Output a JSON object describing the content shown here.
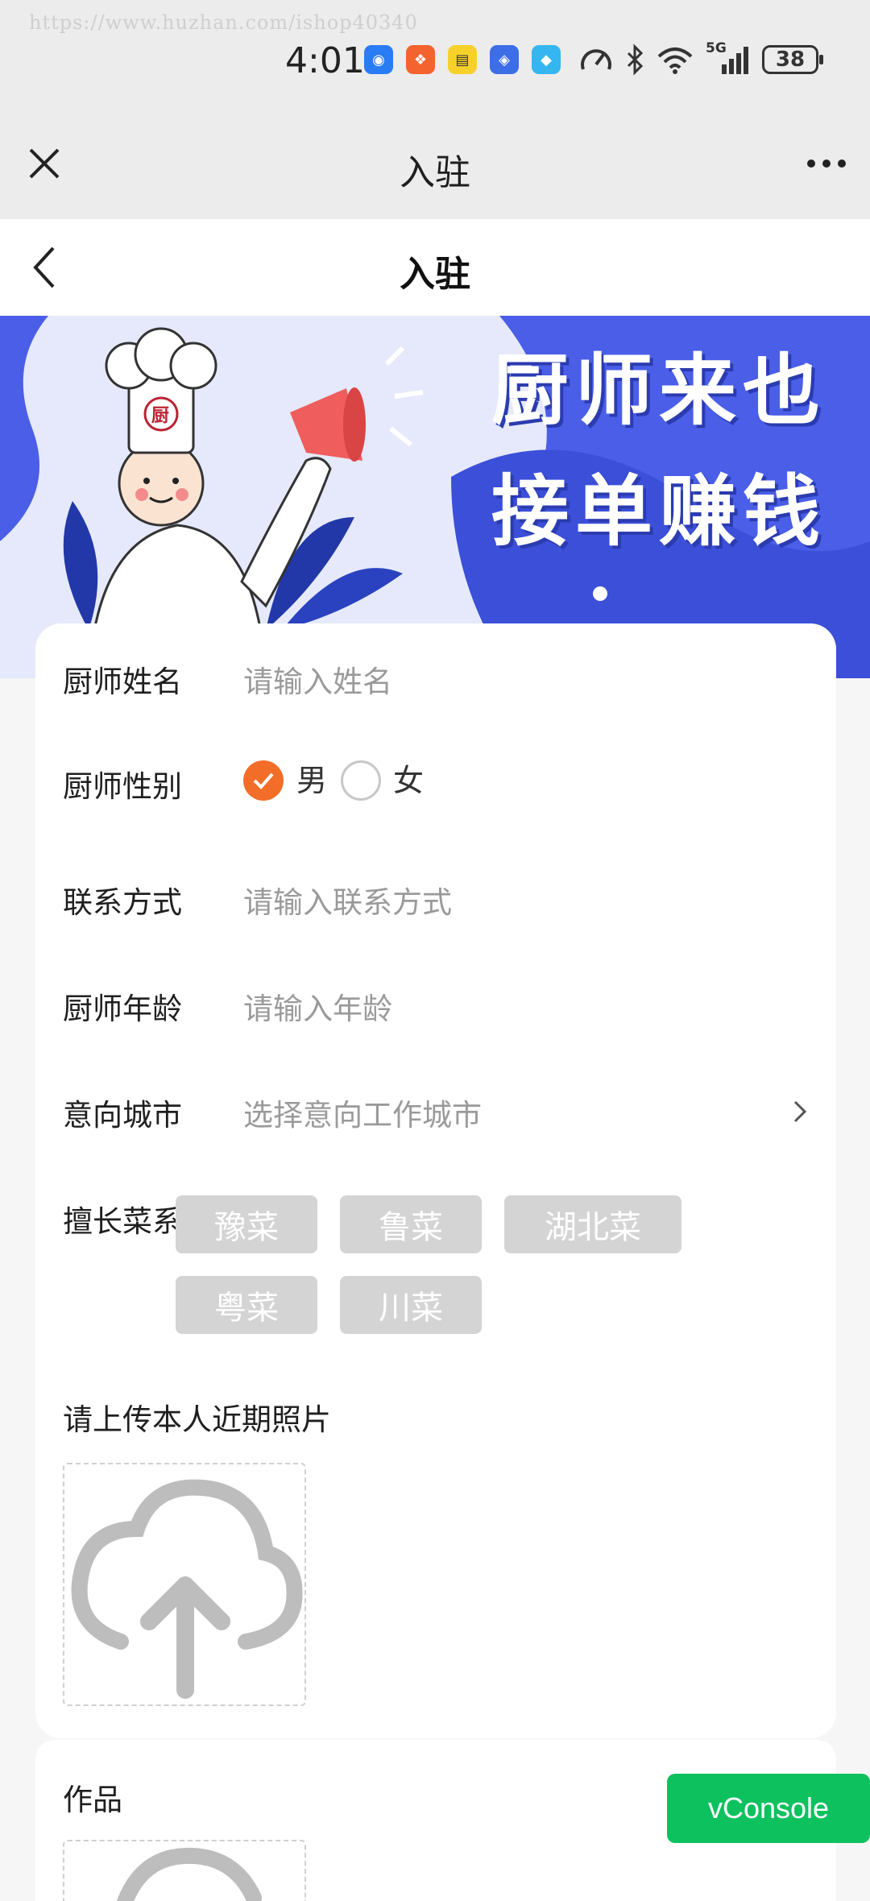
{
  "watermark": "https://www.huzhan.com/ishop40340",
  "status_bar": {
    "time": "4:01",
    "battery": "38",
    "network": "5G"
  },
  "wechat_header": {
    "title": "入驻"
  },
  "page": {
    "title": "入驻"
  },
  "banner": {
    "line1": "厨师来也",
    "line2": "接单赚钱",
    "hat_badge": "厨"
  },
  "form": {
    "name": {
      "label": "厨师姓名",
      "placeholder": "请输入姓名"
    },
    "gender": {
      "label": "厨师性别",
      "options": [
        "男",
        "女"
      ],
      "selected": "男"
    },
    "contact": {
      "label": "联系方式",
      "placeholder": "请输入联系方式"
    },
    "age": {
      "label": "厨师年龄",
      "placeholder": "请输入年龄"
    },
    "city": {
      "label": "意向城市",
      "placeholder": "选择意向工作城市"
    },
    "cuisine": {
      "label": "擅长菜系",
      "tags": [
        "豫菜",
        "鲁菜",
        "湖北菜",
        "粤菜",
        "川菜"
      ]
    },
    "photo": {
      "label": "请上传本人近期照片"
    },
    "works": {
      "label": "作品"
    }
  },
  "vconsole": {
    "label": "vConsole"
  },
  "colors": {
    "accent": "#f26d28",
    "banner_bg": "#4a5ee8",
    "vconsole": "#0ec15f",
    "tag_bg": "#d4d4d4"
  }
}
